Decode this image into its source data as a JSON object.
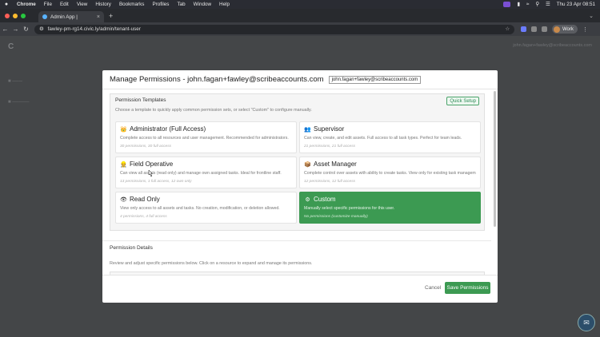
{
  "menubar": {
    "app": "Chrome",
    "items": [
      "File",
      "Edit",
      "View",
      "History",
      "Bookmarks",
      "Profiles",
      "Tab",
      "Window",
      "Help"
    ],
    "datetime": "Thu 23 Apr  08:51"
  },
  "browser": {
    "tab_title": "Admin App |",
    "url": "fawley-pm-rg14.civic.ly/admin/tenant-user",
    "profile_label": "Work"
  },
  "background_page": {
    "top_right_text": "john.fagan+fawley@scribeaccounts.com"
  },
  "modal": {
    "title": "Manage Permissions - john.fagan+fawley@scribeaccounts.com",
    "email_pill": "john.fagan+fawley@scribeaccounts.com",
    "templates": {
      "heading": "Permission Templates",
      "description": "Choose a template to quickly apply common permission sets, or select \"Custom\" to configure manually.",
      "quick_setup_label": "Quick Setup",
      "cards": [
        {
          "icon": "crown-icon",
          "glyph": "👑",
          "title": "Administrator (Full Access)",
          "description": "Complete access to all resources and user management. Recommended for administrators.",
          "meta": "30 permissions, 30 full access",
          "selected": false
        },
        {
          "icon": "supervisor-icon",
          "glyph": "👥",
          "title": "Supervisor",
          "description": "Can view, create, and edit assets. Full access to all task types. Perfect for team leads.",
          "meta": "21 permissions, 21 full access",
          "selected": false
        },
        {
          "icon": "hardhat-icon",
          "glyph": "👷",
          "title": "Field Operative",
          "description": "Can view all assets (read only) and manage own assigned tasks. Ideal for frontline staff.",
          "meta": "13 permissions, 1 full access, 12 own only",
          "selected": false
        },
        {
          "icon": "box-icon",
          "glyph": "📦",
          "title": "Asset Manager",
          "description": "Complete control over assets with ability to create tasks. View only for existing task management.",
          "meta": "12 permissions, 12 full access",
          "selected": false
        },
        {
          "icon": "eye-icon",
          "glyph": "👁",
          "title": "Read Only",
          "description": "View only access to all assets and tasks. No creation, modification, or deletion allowed.",
          "meta": "4 permissions, 4 full access",
          "selected": false
        },
        {
          "icon": "gear-icon",
          "glyph": "⚙",
          "title": "Custom",
          "description": "Manually select specific permissions for this user.",
          "meta": "No permissions (customize manually)",
          "selected": true
        }
      ]
    },
    "details": {
      "heading": "Permission Details",
      "description": "Review and adjust specific permissions below. Click on a resource to expand and manage its permissions."
    },
    "footer": {
      "cancel_label": "Cancel",
      "save_label": "Save Permissions"
    }
  },
  "colors": {
    "accent_green": "#3c9a52",
    "overlay": "#444648"
  }
}
